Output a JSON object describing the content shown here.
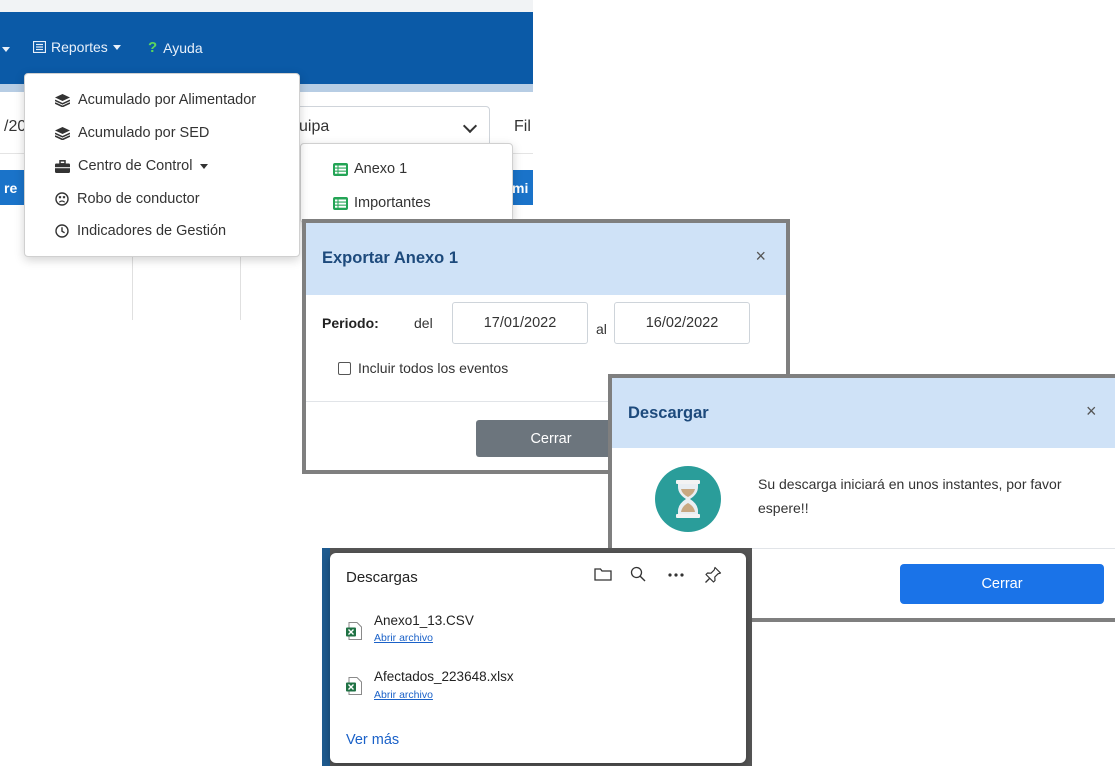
{
  "navbar": {
    "reportes_label": "Reportes",
    "ayuda_label": "Ayuda",
    "ayuda_icon": "?"
  },
  "filters": {
    "date_partial": "/20",
    "select_value": "uipa",
    "filter_partial": "Fil"
  },
  "table": {
    "header_left": "re",
    "header_right": "mi"
  },
  "reportes_menu": {
    "items": [
      {
        "label": "Acumulado por Alimentador",
        "icon": "layers-icon"
      },
      {
        "label": "Acumulado por SED",
        "icon": "layers-icon"
      },
      {
        "label": "Centro de Control",
        "icon": "briefcase-icon"
      },
      {
        "label": "Robo de conductor",
        "icon": "sad-face-icon"
      },
      {
        "label": "Indicadores de Gestión",
        "icon": "clock-icon"
      }
    ]
  },
  "centro_submenu": {
    "items": [
      {
        "label": "Anexo 1",
        "icon": "table-icon"
      },
      {
        "label": "Importantes",
        "icon": "table-icon"
      }
    ]
  },
  "export_modal": {
    "title": "Exportar Anexo 1",
    "close": "×",
    "periodo_label": "Periodo:",
    "del_label": "del",
    "from_date": "17/01/2022",
    "al_label": "al",
    "to_date": "16/02/2022",
    "include_all_label": "Incluir todos los eventos",
    "include_all_checked": false,
    "cerrar_label": "Cerrar"
  },
  "download_modal": {
    "title": "Descargar",
    "close": "×",
    "message": "Su descarga iniciará en unos instantes, por favor espere!!",
    "cerrar_label": "Cerrar"
  },
  "downloads_panel": {
    "title": "Descargas",
    "files": [
      {
        "name": "Anexo1_13.CSV",
        "action": "Abrir archivo"
      },
      {
        "name": "Afectados_223648.xlsx",
        "action": "Abrir archivo"
      }
    ],
    "more_label": "Ver más"
  },
  "colors": {
    "navbar": "#0b5aa7",
    "table_header": "#1a73c9",
    "modal_header": "#cfe2f7",
    "primary_button": "#1a73e8",
    "secondary_button": "#6c757d",
    "hourglass_circle": "#2a9d9a"
  }
}
